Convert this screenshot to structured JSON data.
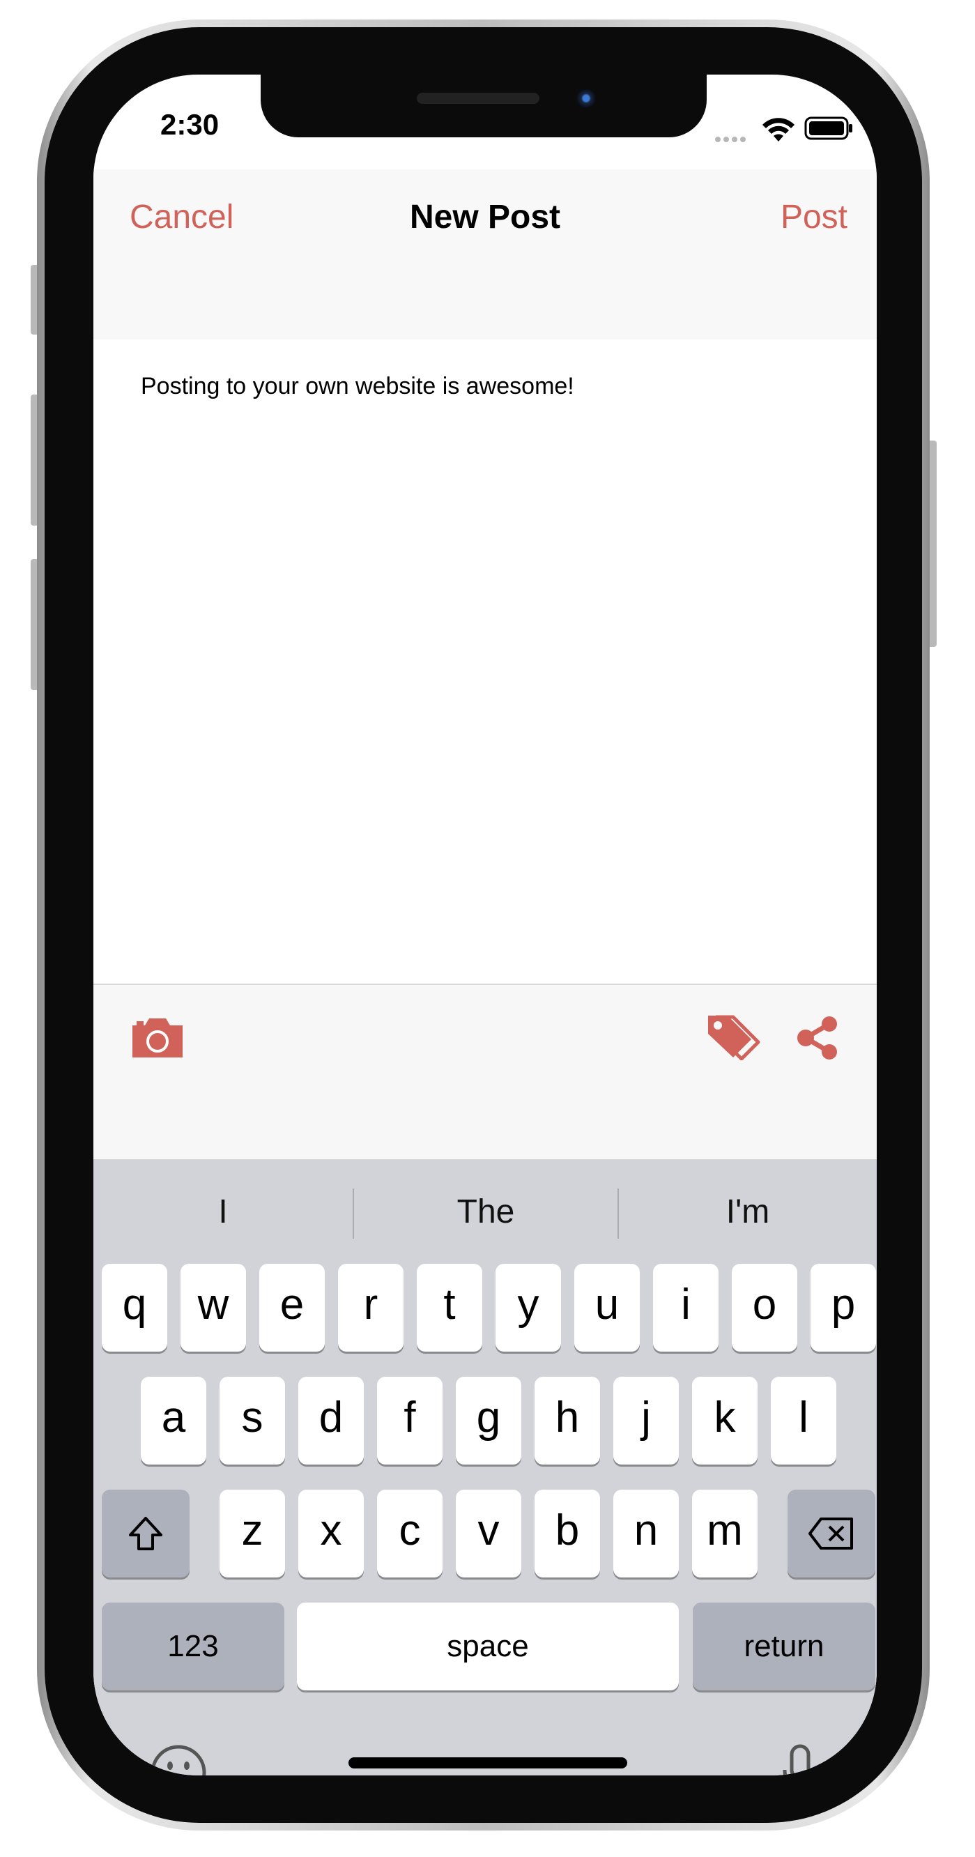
{
  "status_bar": {
    "time": "2:30"
  },
  "nav": {
    "cancel_label": "Cancel",
    "title": "New Post",
    "post_label": "Post"
  },
  "editor": {
    "text": "Posting to your own website is awesome!"
  },
  "toolbar": {
    "camera_icon": "camera-icon",
    "tags_icon": "tags-icon",
    "share_icon": "share-icon"
  },
  "keyboard": {
    "suggestions": [
      "I",
      "The",
      "I'm"
    ],
    "row1": [
      "q",
      "w",
      "e",
      "r",
      "t",
      "y",
      "u",
      "i",
      "o",
      "p"
    ],
    "row2": [
      "a",
      "s",
      "d",
      "f",
      "g",
      "h",
      "j",
      "k",
      "l"
    ],
    "row3": [
      "z",
      "x",
      "c",
      "v",
      "b",
      "n",
      "m"
    ],
    "numbers_label": "123",
    "space_label": "space",
    "return_label": "return"
  },
  "colors": {
    "accent": "#d1625a",
    "keyboard_bg": "#d1d3d9",
    "key_dark": "#adb1bb"
  }
}
